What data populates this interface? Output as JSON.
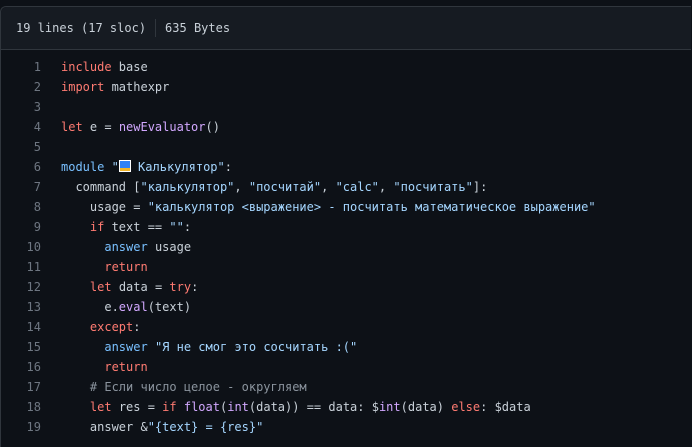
{
  "header": {
    "lines_label": "19 lines (17 sloc)",
    "size_label": "635 Bytes"
  },
  "code": {
    "line_numbers": [
      "1",
      "2",
      "3",
      "4",
      "5",
      "6",
      "7",
      "8",
      "9",
      "10",
      "11",
      "12",
      "13",
      "14",
      "15",
      "16",
      "17",
      "18",
      "19"
    ],
    "lines": [
      [
        "include",
        " base"
      ],
      [
        "import",
        " mathexpr"
      ],
      [],
      [
        "let",
        " e = ",
        "newEvaluator",
        "()"
      ],
      [],
      [
        "module",
        " ",
        "\"",
        "📊",
        " Калькулятор\"",
        ":"
      ],
      [
        "  command [",
        "\"калькулятор\"",
        ", ",
        "\"посчитай\"",
        ", ",
        "\"calc\"",
        ", ",
        "\"посчитать\"",
        "]:"
      ],
      [
        "    usage = ",
        "\"калькулятор <выражение> - посчитать математическое выражение\""
      ],
      [
        "    ",
        "if",
        " text == ",
        "\"\"",
        ":"
      ],
      [
        "      ",
        "answer",
        " usage"
      ],
      [
        "      ",
        "return"
      ],
      [
        "    ",
        "let",
        " data = ",
        "try",
        ":"
      ],
      [
        "      e.",
        "eval",
        "(text)"
      ],
      [
        "    ",
        "except",
        ":"
      ],
      [
        "      ",
        "answer",
        " ",
        "\"Я не смог это сосчитать :(\""
      ],
      [
        "      ",
        "return"
      ],
      [
        "    ",
        "# Если число целое - округляем"
      ],
      [
        "    ",
        "let",
        " res = ",
        "if",
        " ",
        "float",
        "(",
        "int",
        "(data)) == data: $",
        "int",
        "(data) ",
        "else",
        ": $data"
      ],
      [
        "    answer &",
        "\"{text} = {res}\""
      ]
    ]
  },
  "colors": {
    "background": "#0d1117",
    "keyword": "#ff7b72",
    "function": "#d2a8ff",
    "string": "#a5d6ff",
    "comment": "#8b949e",
    "builtin": "#79c0ff"
  }
}
